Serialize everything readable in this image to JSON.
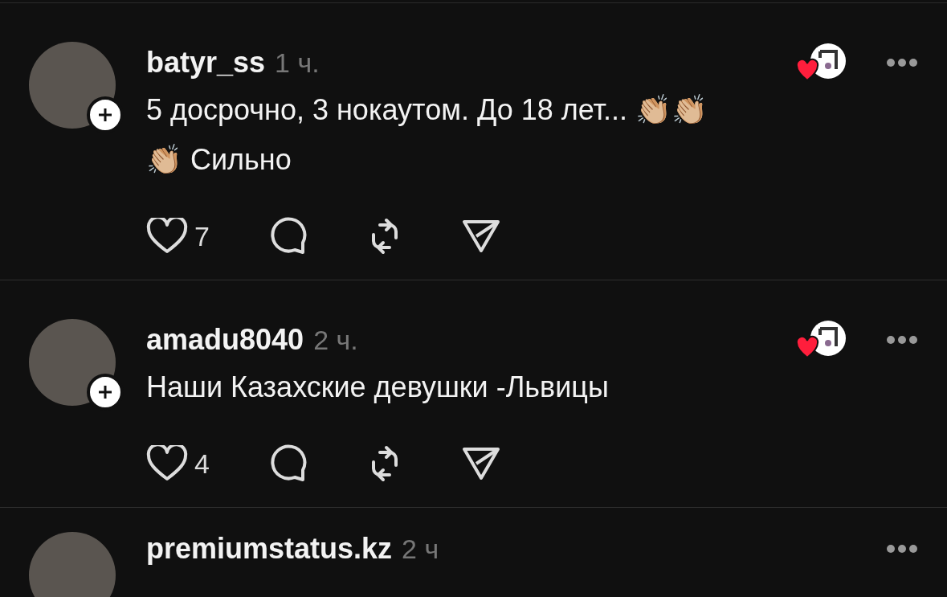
{
  "posts": [
    {
      "username": "batyr_ss",
      "time": "1 ч.",
      "text": "5 досрочно, 3 нокаутом. До 18 лет... 👏🏼👏🏼 👏🏼 Сильно",
      "likes": "7"
    },
    {
      "username": "amadu8040",
      "time": "2 ч.",
      "text": "Наши Казахские девушки -Львицы",
      "likes": "4"
    },
    {
      "username": "premiumstatus.kz",
      "time": "2 ч"
    }
  ]
}
